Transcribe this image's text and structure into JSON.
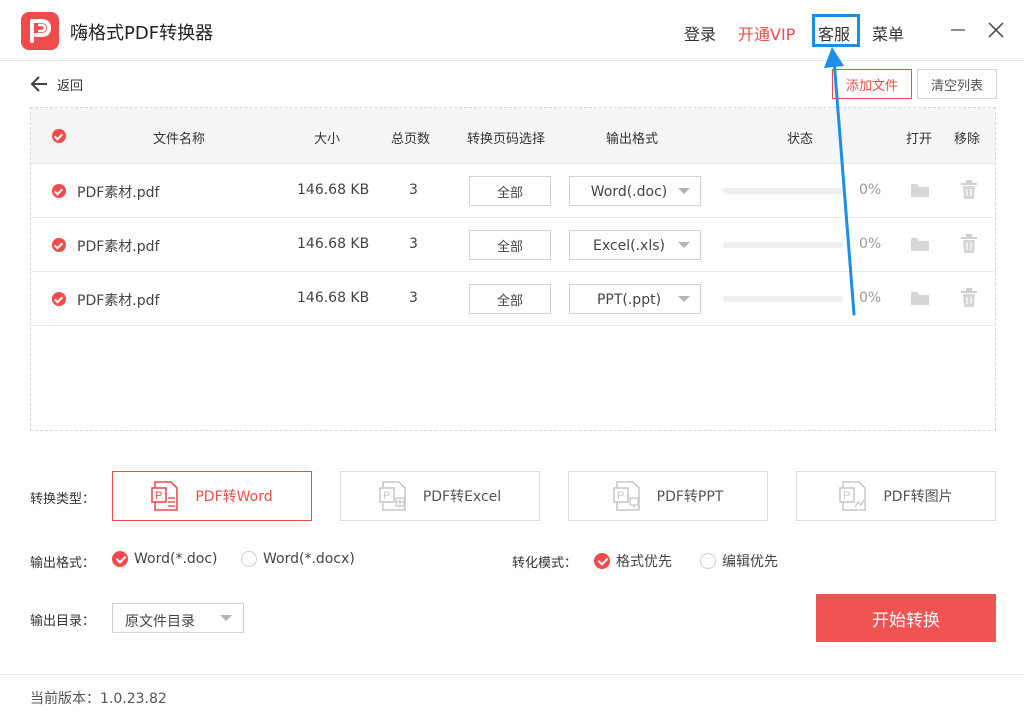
{
  "app": {
    "title": "嗨格式PDF转换器"
  },
  "topnav": {
    "login": "登录",
    "vip": "开通VIP",
    "service": "客服",
    "menu": "菜单"
  },
  "toolbar": {
    "back": "返回",
    "add_file": "添加文件",
    "clear_list": "清空列表"
  },
  "table": {
    "headers": {
      "name": "文件名称",
      "size": "大小",
      "pages": "总页数",
      "range": "转换页码选择",
      "format": "输出格式",
      "status": "状态",
      "open": "打开",
      "remove": "移除"
    },
    "rows": [
      {
        "name": "PDF素材.pdf",
        "size": "146.68 KB",
        "pages": "3",
        "range": "全部",
        "format": "Word(.doc)",
        "progress": 0,
        "percent": "0%"
      },
      {
        "name": "PDF素材.pdf",
        "size": "146.68 KB",
        "pages": "3",
        "range": "全部",
        "format": "Excel(.xls)",
        "progress": 0,
        "percent": "0%"
      },
      {
        "name": "PDF素材.pdf",
        "size": "146.68 KB",
        "pages": "3",
        "range": "全部",
        "format": "PPT(.ppt)",
        "progress": 0,
        "percent": "0%"
      }
    ]
  },
  "convert_type": {
    "label": "转换类型：",
    "options": [
      {
        "label": "PDF转Word",
        "active": true
      },
      {
        "label": "PDF转Excel",
        "active": false
      },
      {
        "label": "PDF转PPT",
        "active": false
      },
      {
        "label": "PDF转图片",
        "active": false
      }
    ]
  },
  "output_format": {
    "label": "输出格式：",
    "options": [
      {
        "label": "Word(*.doc)",
        "selected": true
      },
      {
        "label": "Word(*.docx)",
        "selected": false
      }
    ]
  },
  "convert_mode": {
    "label": "转化模式：",
    "options": [
      {
        "label": "格式优先",
        "selected": true
      },
      {
        "label": "编辑优先",
        "selected": false
      }
    ]
  },
  "output_dir": {
    "label": "输出目录：",
    "value": "原文件目录"
  },
  "start_button": "开始转换",
  "version": "当前版本：1.0.23.82",
  "colors": {
    "accent": "#f04c4c",
    "highlight": "#1d8ee8"
  },
  "icons": [
    "pdf-logo-icon",
    "minimize-icon",
    "close-icon",
    "back-arrow-icon",
    "folder-icon",
    "trash-icon",
    "chevron-down-icon",
    "word-doc-icon",
    "excel-doc-icon",
    "ppt-doc-icon",
    "image-doc-icon",
    "annotation-arrow"
  ]
}
